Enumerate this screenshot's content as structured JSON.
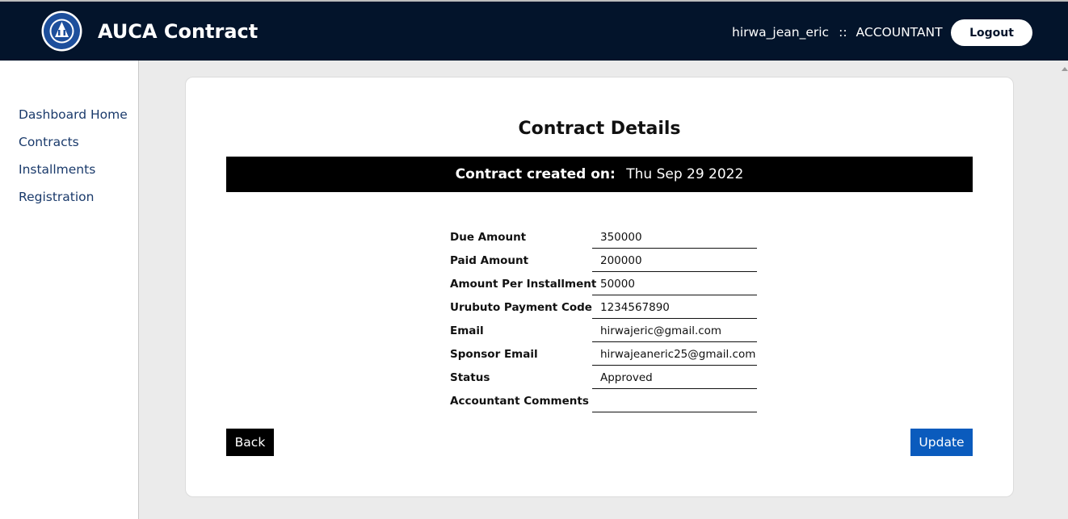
{
  "header": {
    "logo_icon": "auca-logo-icon",
    "app_title": "AUCA Contract",
    "username": "hirwa_jean_eric",
    "separator": "::",
    "role": "ACCOUNTANT",
    "logout_label": "Logout",
    "background_color": "#03142b"
  },
  "sidebar": {
    "items": [
      {
        "label": "Dashboard Home"
      },
      {
        "label": "Contracts"
      },
      {
        "label": "Installments"
      },
      {
        "label": "Registration"
      }
    ],
    "link_color": "#1a3a6b"
  },
  "contract": {
    "title": "Contract Details",
    "created_label": "Contract created on:",
    "created_date": "Thu Sep 29 2022",
    "fields": [
      {
        "label": "Due Amount",
        "value": "350000"
      },
      {
        "label": "Paid Amount",
        "value": "200000"
      },
      {
        "label": "Amount Per Installment",
        "value": "50000"
      },
      {
        "label": "Urubuto Payment Code",
        "value": "1234567890"
      },
      {
        "label": "Email",
        "value": "hirwajeric@gmail.com"
      },
      {
        "label": "Sponsor Email",
        "value": "hirwajeaneric25@gmail.com"
      },
      {
        "label": "Status",
        "value": "Approved"
      },
      {
        "label": "Accountant Comments",
        "value": ""
      }
    ]
  },
  "actions": {
    "back_label": "Back",
    "update_label": "Update",
    "update_color": "#0a5bbd"
  }
}
